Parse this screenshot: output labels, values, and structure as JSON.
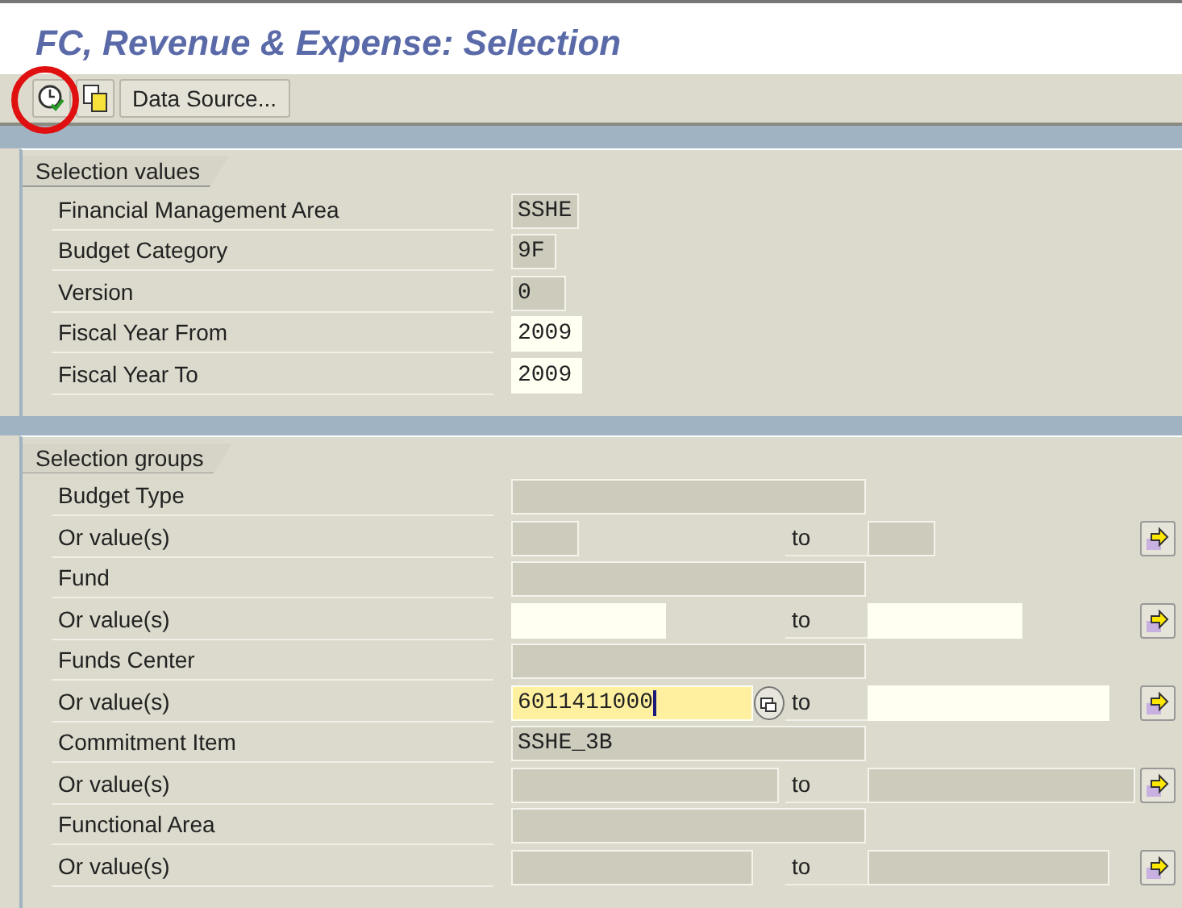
{
  "title": "FC, Revenue & Expense: Selection",
  "toolbar": {
    "buttons": [
      {
        "kind": "execute",
        "highlighted": true
      },
      {
        "kind": "copy",
        "highlighted": false
      },
      {
        "kind": "text",
        "label": "Data Source...",
        "highlighted": false
      }
    ]
  },
  "sections": [
    {
      "title": "Selection values",
      "rows": [
        {
          "kind": "single",
          "label": "Financial Management Area",
          "field": {
            "text": "SSHE",
            "editable": false,
            "focused": false
          }
        },
        {
          "kind": "single",
          "label": "Budget Category",
          "field": {
            "text": "9F",
            "editable": false,
            "focused": false
          }
        },
        {
          "kind": "single",
          "label": "Version",
          "field": {
            "text": "0",
            "editable": false,
            "focused": false
          }
        },
        {
          "kind": "single",
          "label": "Fiscal Year From",
          "field": {
            "text": "2009",
            "editable": true,
            "focused": false
          }
        },
        {
          "kind": "single",
          "label": "Fiscal Year To",
          "field": {
            "text": "2009",
            "editable": true,
            "focused": false
          }
        }
      ]
    },
    {
      "title": "Selection groups",
      "rows": [
        {
          "kind": "single",
          "label": "Budget Type",
          "field": {
            "editable": false,
            "focused": false
          }
        },
        {
          "kind": "range",
          "label": "Or value(s)",
          "from": {
            "editable": false,
            "focused": false
          },
          "to_label": "to",
          "to": {
            "editable": false,
            "focused": false
          }
        },
        {
          "kind": "single",
          "label": "Fund",
          "field": {
            "editable": false,
            "focused": false
          }
        },
        {
          "kind": "range",
          "label": "Or value(s)",
          "from": {
            "editable": true,
            "focused": false
          },
          "to_label": "to",
          "to": {
            "editable": true,
            "focused": false
          }
        },
        {
          "kind": "single",
          "label": "Funds Center",
          "field": {
            "editable": false,
            "focused": false
          }
        },
        {
          "kind": "range",
          "label": "Or value(s)",
          "from": {
            "text": "6011411000",
            "editable": true,
            "focused": true
          },
          "to_label": "to",
          "to": {
            "editable": true,
            "focused": false
          }
        },
        {
          "kind": "single",
          "label": "Commitment Item",
          "field": {
            "text": "SSHE_3B",
            "editable": false,
            "focused": false
          }
        },
        {
          "kind": "range",
          "label": "Or value(s)",
          "from": {
            "editable": false,
            "focused": false
          },
          "to_label": "to",
          "to": {
            "editable": false,
            "focused": false
          }
        },
        {
          "kind": "single",
          "label": "Functional Area",
          "field": {
            "editable": false,
            "focused": false
          }
        },
        {
          "kind": "range",
          "label": "Or value(s)",
          "from": {
            "editable": false,
            "focused": false
          },
          "to_label": "to",
          "to": {
            "editable": false,
            "focused": false
          }
        }
      ]
    }
  ]
}
